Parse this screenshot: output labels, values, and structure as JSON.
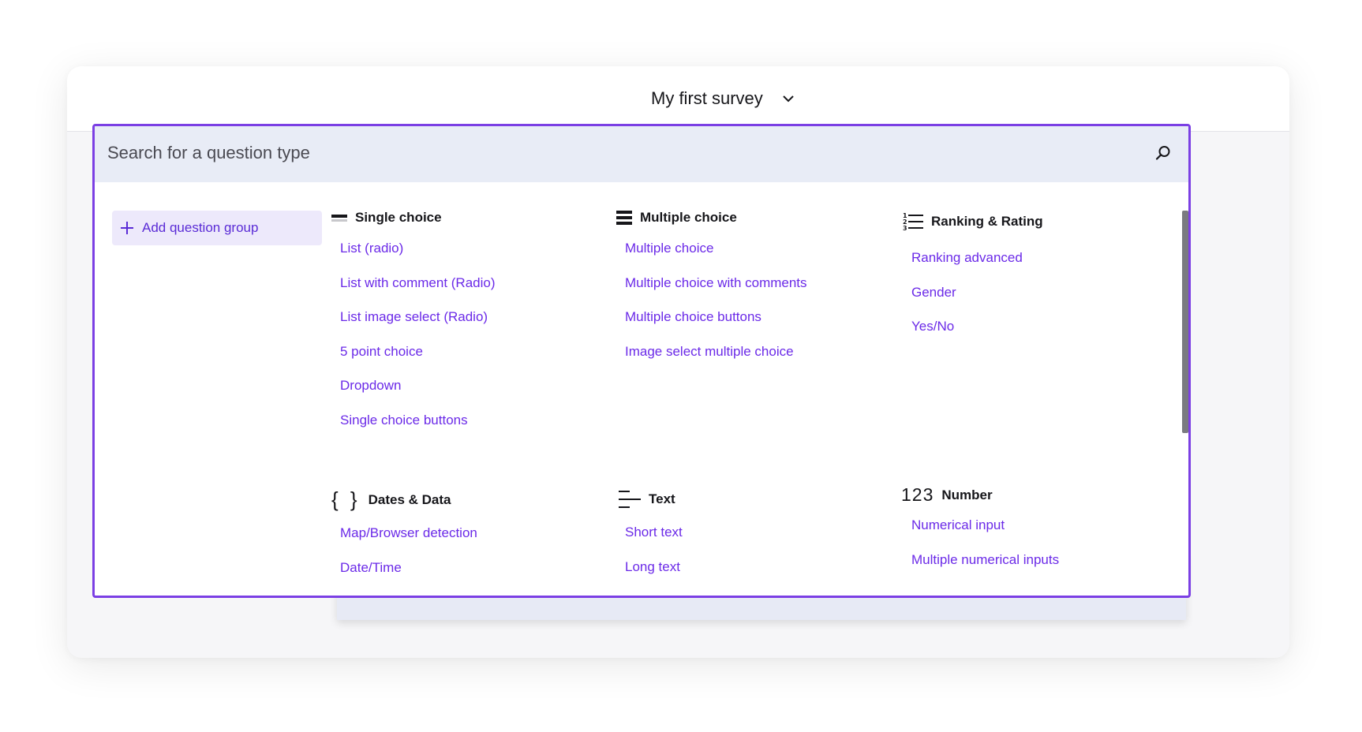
{
  "header": {
    "survey_title": "My first survey"
  },
  "search": {
    "placeholder": "Search for a question type"
  },
  "sidebar": {
    "add_group_label": "Add question group"
  },
  "categories": {
    "single": {
      "title": "Single choice",
      "items": [
        "List (radio)",
        "List with comment (Radio)",
        "List image select (Radio)",
        "5 point choice",
        "Dropdown",
        "Single choice buttons"
      ]
    },
    "multiple": {
      "title": "Multiple choice",
      "items": [
        "Multiple choice",
        "Multiple choice with comments",
        "Multiple choice buttons",
        "Image select multiple choice"
      ]
    },
    "ranking": {
      "title": "Ranking & Rating",
      "items": [
        "Ranking advanced",
        "Gender",
        "Yes/No"
      ]
    },
    "dates": {
      "title": "Dates & Data",
      "icon_glyph": "{ }",
      "items": [
        "Map/Browser detection",
        "Date/Time"
      ]
    },
    "text": {
      "title": "Text",
      "items": [
        "Short text",
        "Long text"
      ]
    },
    "number": {
      "title": "Number",
      "icon_glyph": "123",
      "items": [
        "Numerical input",
        "Multiple numerical inputs"
      ]
    }
  },
  "colors": {
    "accent": "#7b3fe4",
    "link": "#6b2ae8",
    "search_bg": "#e8ecf6",
    "add_group_bg": "#ede9fb"
  },
  "icons": {
    "title_dropdown": "chevron-down-icon",
    "search": "search-icon",
    "add": "plus-icon",
    "single": "single-choice-icon",
    "multiple": "multiple-choice-icon",
    "ranking": "ranking-list-icon",
    "dates": "braces-icon",
    "text": "text-lines-icon",
    "number": "number-icon"
  }
}
